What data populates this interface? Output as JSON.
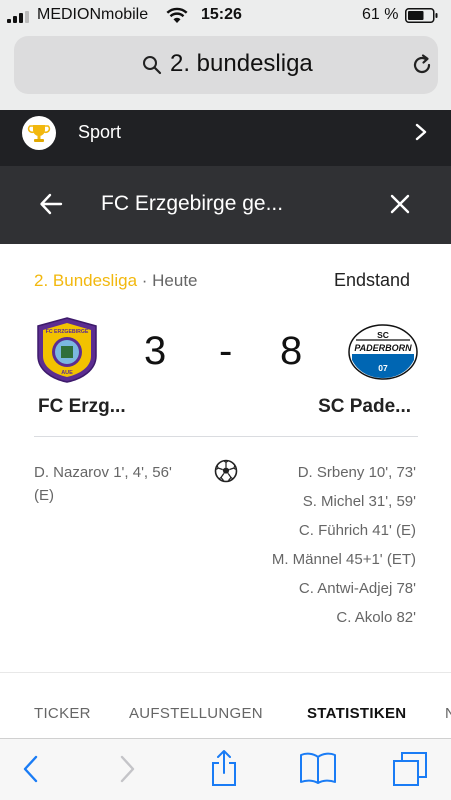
{
  "status": {
    "carrier": "MEDIONmobile",
    "time": "15:26",
    "battery": "61 %"
  },
  "browser": {
    "address": "2. bundesliga"
  },
  "sport_bar": {
    "label": "Sport"
  },
  "team_bar": {
    "title": "FC Erzgebirge ge..."
  },
  "match": {
    "league": "2. Bundesliga",
    "meta": " · Heute",
    "status": "Endstand",
    "home": {
      "name": "FC Erzg...",
      "score": "3",
      "crest_text": "FC ERZGEBIRGE",
      "crest_sub": "AUE"
    },
    "separator": "-",
    "away": {
      "name": "SC Pade...",
      "score": "8",
      "crest_text": "PADERBORN",
      "crest_sc": "SC",
      "crest_num": "07"
    },
    "home_scorers": [
      "D. Nazarov 1', 4', 56' (E)"
    ],
    "away_scorers": [
      "D. Srbeny 10', 73'",
      "S. Michel 31', 59'",
      "C. Führich 41' (E)",
      "M. Männel 45+1' (ET)",
      "C. Antwi-Adjej 78'",
      "C. Akolo 82'"
    ]
  },
  "tabs": [
    {
      "label": "TICKER",
      "active": false
    },
    {
      "label": "AUFSTELLUNGEN",
      "active": false
    },
    {
      "label": "STATISTIKEN",
      "active": true
    },
    {
      "label": "N",
      "active": false
    }
  ],
  "colors": {
    "league": "#f2b80e",
    "accent_purple": "#5c2d91",
    "paderborn_blue": "#0066b3"
  },
  "icons": [
    "search-icon",
    "reload-icon",
    "trophy-icon",
    "chevron-right-icon",
    "back-arrow-icon",
    "close-icon",
    "soccer-ball-icon",
    "back-icon",
    "forward-icon",
    "share-icon",
    "bookmarks-icon",
    "tabs-icon"
  ]
}
